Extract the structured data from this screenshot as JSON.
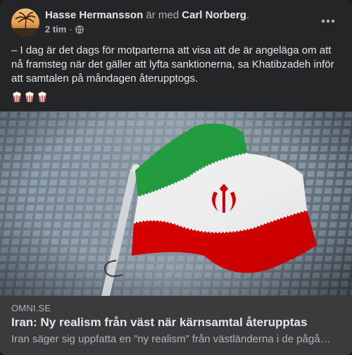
{
  "header": {
    "author": "Hasse Hermansson",
    "with_text": "är med",
    "tagged": "Carl Norberg",
    "tagged_suffix": ".",
    "time": "2 tim",
    "dot": "·",
    "privacy_icon": "globe-icon",
    "more_icon": "more-horizontal-icon"
  },
  "post": {
    "text": "– I dag är det dags för motparterna att visa att de är angeläga om att nå framsteg när det gäller att lyfta sanktionerna, sa Khatibzadeh inför att samtalen på måndagen återupptogs.",
    "emojis": [
      "popcorn-icon",
      "popcorn-icon",
      "popcorn-icon"
    ]
  },
  "link": {
    "source": "OMNI.SE",
    "headline": "Iran: Ny realism från väst när kärnsamtal återupptas",
    "description": "Iran säger sig uppfatta en ”ny realism” från västländerna i de pågående samtalen om kärnenergiavtalet."
  },
  "colors": {
    "card_bg": "#242526",
    "link_bg": "#3a3b3c",
    "primary_text": "#e4e6eb",
    "secondary_text": "#b0b3b8",
    "flag_green": "#239f40",
    "flag_white": "#ffffff",
    "flag_red": "#da0000"
  }
}
